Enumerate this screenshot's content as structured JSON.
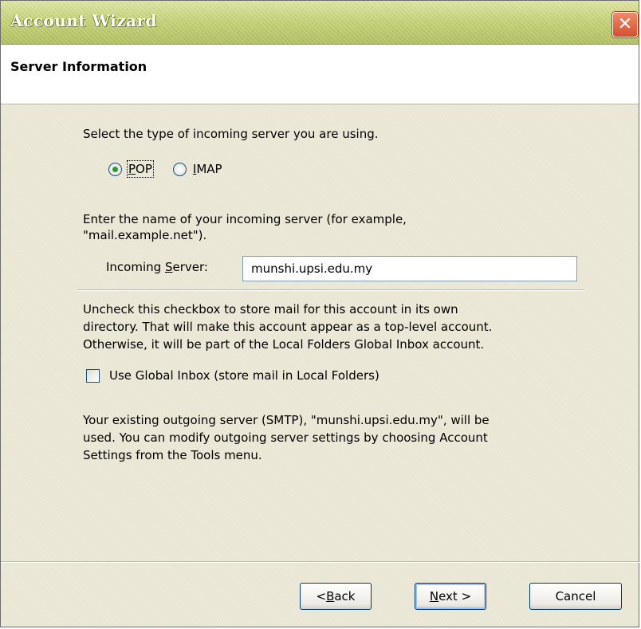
{
  "window": {
    "title": "Account Wizard",
    "close_symbol": "✕"
  },
  "header": {
    "title": "Server Information"
  },
  "server_type": {
    "prompt": "Select the type of incoming server you are using.",
    "options": [
      {
        "label_pre": "",
        "label_ul": "P",
        "label_post": "OP",
        "selected": true
      },
      {
        "label_pre": "",
        "label_ul": "I",
        "label_post": "MAP",
        "selected": false
      }
    ]
  },
  "incoming": {
    "prompt_line1": "Enter the name of your incoming server (for example,",
    "prompt_line2": "\"mail.example.net\").",
    "label_pre": "Incoming ",
    "label_ul": "S",
    "label_post": "erver:",
    "value": "munshi.upsi.edu.my"
  },
  "global_inbox": {
    "desc_line1": "Uncheck this checkbox to store mail for this account in its own",
    "desc_line2": "directory. That will make this account appear as a top-level account.",
    "desc_line3": "Otherwise, it will be part of the Local Folders Global Inbox account.",
    "checkbox_label": "Use Global Inbox (store mail in Local Folders)",
    "checked": false
  },
  "outgoing": {
    "line1": "Your existing outgoing server (SMTP), \"munshi.upsi.edu.my\", will be",
    "line2": "used. You can modify outgoing server settings by choosing Account",
    "line3": "Settings from the Tools menu."
  },
  "buttons": {
    "back_pre": "< ",
    "back_ul": "B",
    "back_post": "ack",
    "next_pre": "",
    "next_ul": "N",
    "next_post": "ext >",
    "cancel": "Cancel"
  }
}
